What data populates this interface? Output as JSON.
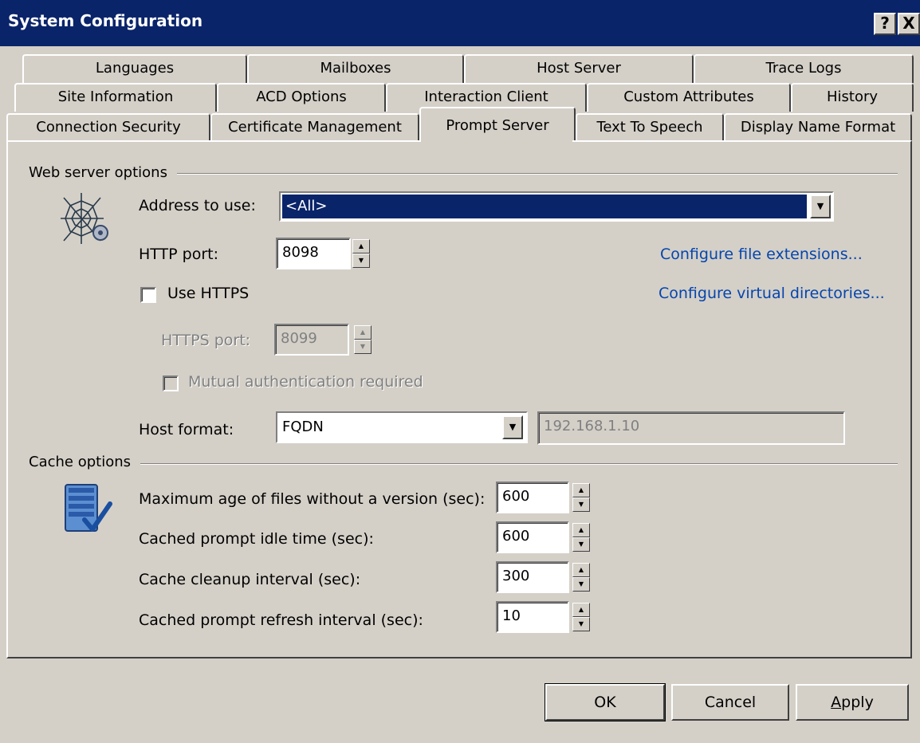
{
  "window": {
    "title": "System Configuration",
    "help_label": "?",
    "close_label": "X"
  },
  "tabs": {
    "row1": [
      "Languages",
      "Mailboxes",
      "Host Server",
      "Trace Logs"
    ],
    "row2": [
      "Site Information",
      "ACD Options",
      "Interaction Client",
      "Custom Attributes",
      "History"
    ],
    "row3": [
      "Connection Security",
      "Certificate Management",
      "Prompt Server",
      "Text To Speech",
      "Display Name Format"
    ],
    "active": "Prompt Server"
  },
  "web_server": {
    "group_label": "Web server options",
    "address_label": "Address to use:",
    "address_value": "<All>",
    "http_port_label": "HTTP port:",
    "http_port_value": "8098",
    "use_https_label": "Use HTTPS",
    "use_https_checked": false,
    "https_port_label": "HTTPS port:",
    "https_port_value": "8099",
    "mutual_auth_label": "Mutual authentication required",
    "mutual_auth_checked": false,
    "host_format_label": "Host format:",
    "host_format_value": "FQDN",
    "host_address_value": "192.168.1.10",
    "configure_file_ext_link": "Configure file extensions...",
    "configure_virtual_dirs_link": "Configure virtual directories..."
  },
  "cache": {
    "group_label": "Cache options",
    "rows": [
      {
        "label": "Maximum age of files without a version (sec):",
        "value": "600"
      },
      {
        "label": "Cached prompt idle time (sec):",
        "value": "600"
      },
      {
        "label": "Cache cleanup interval (sec):",
        "value": "300"
      },
      {
        "label": "Cached prompt refresh interval (sec):",
        "value": "10"
      }
    ]
  },
  "buttons": {
    "ok": "OK",
    "cancel": "Cancel",
    "apply": "Apply",
    "apply_accel": "A",
    "apply_rest": "pply"
  },
  "icons": {
    "web": "spider-web-icon",
    "cache": "server-check-icon"
  }
}
